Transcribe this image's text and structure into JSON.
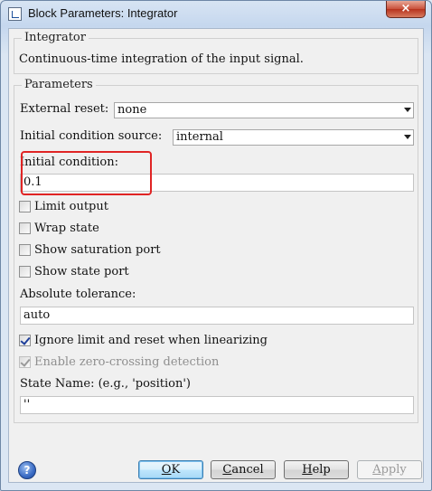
{
  "window": {
    "title": "Block Parameters: Integrator",
    "close_glyph": "×"
  },
  "description_group": {
    "title": "Integrator",
    "text": "Continuous-time integration of the input signal."
  },
  "parameters_group": {
    "title": "Parameters",
    "external_reset": {
      "label": "External reset:",
      "value": "none"
    },
    "initial_condition_source": {
      "label": "Initial condition source:",
      "value": "internal"
    },
    "initial_condition": {
      "label": "Initial condition:",
      "value": "0.1"
    },
    "limit_output": {
      "label": "Limit output",
      "checked": false
    },
    "wrap_state": {
      "label": "Wrap state",
      "checked": false
    },
    "show_saturation_port": {
      "label": "Show saturation port",
      "checked": false
    },
    "show_state_port": {
      "label": "Show state port",
      "checked": false
    },
    "absolute_tolerance": {
      "label": "Absolute tolerance:",
      "value": "auto"
    },
    "ignore_limit": {
      "label": "Ignore limit and reset when linearizing",
      "checked": true
    },
    "zero_crossing": {
      "label": "Enable zero-crossing detection",
      "checked": true,
      "disabled": true
    },
    "state_name": {
      "label": "State Name: (e.g., 'position')",
      "value": "''"
    }
  },
  "buttons": {
    "help_icon": "?",
    "ok": {
      "pre": "",
      "key": "O",
      "post": "K"
    },
    "cancel": {
      "pre": "",
      "key": "C",
      "post": "ancel"
    },
    "help": {
      "pre": "",
      "key": "H",
      "post": "elp"
    },
    "apply": {
      "pre": "",
      "key": "A",
      "post": "pply"
    }
  },
  "colors": {
    "highlight": "#e02424",
    "titlebar": "#c5d7ee",
    "close": "#c9503a"
  }
}
